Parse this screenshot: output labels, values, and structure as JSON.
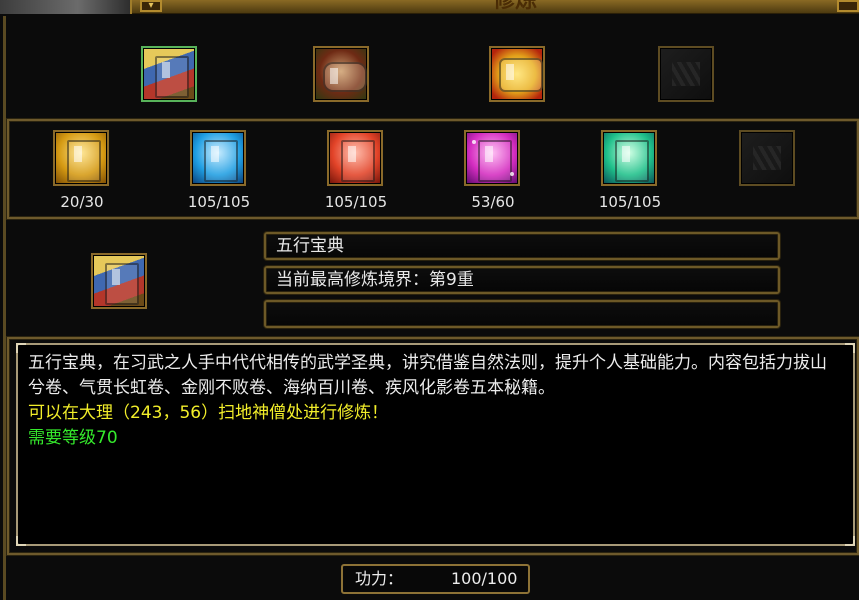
{
  "window": {
    "title": "修炼"
  },
  "top_row": [
    {
      "icon": "wuxing-book-icon",
      "selected": true
    },
    {
      "icon": "scroll-bundle-icon",
      "selected": false
    },
    {
      "icon": "golden-treasure-icon",
      "selected": false
    },
    {
      "icon": "empty-slot-icon",
      "selected": false
    }
  ],
  "books": [
    {
      "icon": "gold-book-icon",
      "count": "20/30"
    },
    {
      "icon": "blue-book-icon",
      "count": "105/105"
    },
    {
      "icon": "red-book-icon",
      "count": "105/105"
    },
    {
      "icon": "purple-book-icon",
      "count": "53/60"
    },
    {
      "icon": "green-book-icon",
      "count": "105/105"
    },
    {
      "icon": "empty-slot-icon",
      "count": ""
    }
  ],
  "detail": {
    "name": "五行宝典",
    "realm": "当前最高修炼境界：第9重",
    "extra": ""
  },
  "description": {
    "text": "五行宝典，在习武之人手中代代相传的武学圣典，讲究借鉴自然法则，提升个人基础能力。内容包括力拔山兮卷、气贯长虹卷、金刚不败卷、海纳百川卷、疾风化影卷五本秘籍。",
    "location": "可以在大理（243，56）扫地神僧处进行修炼！",
    "requirement": "需要等级70"
  },
  "power": {
    "label": "功力：",
    "value": "100/100"
  },
  "colors": {
    "frame": "#6e5a2c",
    "highlight_yellow": "#f2ee2a",
    "requirement_green": "#35ea2c"
  }
}
